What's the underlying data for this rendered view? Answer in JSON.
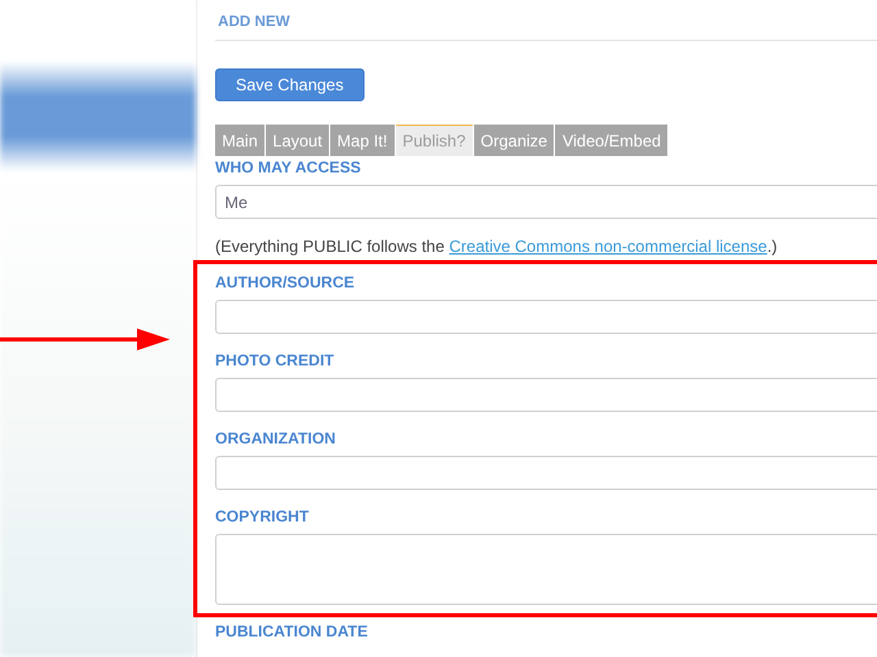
{
  "header": {
    "title": "ADD NEW"
  },
  "save_button": "Save Changes",
  "tabs": [
    {
      "label": "Main",
      "selected": false
    },
    {
      "label": "Layout",
      "selected": false
    },
    {
      "label": "Map It!",
      "selected": false
    },
    {
      "label": "Publish?",
      "selected": true
    },
    {
      "label": "Organize",
      "selected": false
    },
    {
      "label": "Video/Embed",
      "selected": false
    }
  ],
  "access": {
    "label": "WHO MAY ACCESS",
    "value": "Me"
  },
  "note": {
    "before": "(Everything PUBLIC follows the ",
    "link": "Creative Commons non-commercial license",
    "after": ".)"
  },
  "highlighted_fields": [
    {
      "label": "AUTHOR/SOURCE",
      "kind": "input"
    },
    {
      "label": "PHOTO CREDIT",
      "kind": "input"
    },
    {
      "label": "ORGANIZATION",
      "kind": "input"
    },
    {
      "label": "COPYRIGHT",
      "kind": "textarea"
    }
  ],
  "publication_date": {
    "label": "PUBLICATION DATE"
  }
}
